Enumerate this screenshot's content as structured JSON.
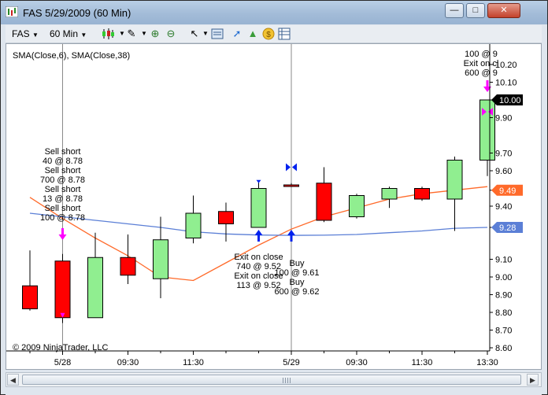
{
  "window": {
    "title": "FAS  5/29/2009 (60 Min)",
    "app_icon": "ninjatrader-chart-icon",
    "controls": {
      "minimize": "minimize-icon",
      "maximize": "maximize-icon",
      "close": "close-icon"
    }
  },
  "toolbar": {
    "instrument": "FAS",
    "interval": "60 Min",
    "icons": [
      "chart-style-candlestick-icon",
      "pencil-draw-icon",
      "zoom-in-icon",
      "zoom-out-icon",
      "pointer-cursor-icon",
      "data-box-icon",
      "indicators-icon",
      "strategies-icon",
      "money-management-icon",
      "properties-grid-icon"
    ]
  },
  "chart_data": {
    "type": "candlestick",
    "instrument": "FAS",
    "indicator_label": "SMA(Close,6), SMA(Close,38)",
    "copyright": "© 2009 NinjaTrader, LLC",
    "yaxis_ticks": [
      "10.20",
      "10.10",
      "10.00",
      "9.90",
      "9.70",
      "9.60",
      "9.49",
      "9.40",
      "9.28",
      "9.10",
      "9.00",
      "8.90",
      "8.80",
      "8.70",
      "8.60"
    ],
    "xaxis_ticks": [
      {
        "label": "5/28",
        "bar": 1
      },
      {
        "label": "09:30",
        "bar": 3
      },
      {
        "label": "11:30",
        "bar": 5
      },
      {
        "label": "5/29",
        "bar": 8
      },
      {
        "label": "09:30",
        "bar": 10
      },
      {
        "label": "11:30",
        "bar": 12
      },
      {
        "label": "13:30",
        "bar": 14
      }
    ],
    "ylim": [
      8.57,
      10.27
    ],
    "bars": [
      {
        "open": 8.95,
        "high": 9.15,
        "low": 8.81,
        "close": 8.82
      },
      {
        "open": 9.09,
        "high": 9.13,
        "low": 8.74,
        "close": 8.77
      },
      {
        "open": 8.77,
        "high": 9.25,
        "low": 8.77,
        "close": 9.11
      },
      {
        "open": 9.11,
        "high": 9.24,
        "low": 8.96,
        "close": 9.01
      },
      {
        "open": 8.99,
        "high": 9.34,
        "low": 8.88,
        "close": 9.21
      },
      {
        "open": 9.22,
        "high": 9.46,
        "low": 9.19,
        "close": 9.36
      },
      {
        "open": 9.37,
        "high": 9.42,
        "low": 9.2,
        "close": 9.3
      },
      {
        "open": 9.28,
        "high": 9.54,
        "low": 9.28,
        "close": 9.5
      },
      {
        "open": 9.52,
        "high": 9.53,
        "low": 9.52,
        "close": 9.52
      },
      {
        "open": 9.53,
        "high": 9.62,
        "low": 9.31,
        "close": 9.32
      },
      {
        "open": 9.34,
        "high": 9.47,
        "low": 9.33,
        "close": 9.46
      },
      {
        "open": 9.44,
        "high": 9.51,
        "low": 9.39,
        "close": 9.5
      },
      {
        "open": 9.5,
        "high": 9.51,
        "low": 9.43,
        "close": 9.44
      },
      {
        "open": 9.44,
        "high": 9.68,
        "low": 9.26,
        "close": 9.66
      },
      {
        "open": 9.66,
        "high": 10.0,
        "low": 9.57,
        "close": 10.0
      }
    ],
    "series": [
      {
        "name": "SMA(Close,6)",
        "color": "#ff6a2a",
        "values": [
          9.45,
          9.33,
          9.22,
          9.12,
          9.0,
          8.98,
          9.08,
          9.18,
          9.27,
          9.34,
          9.39,
          9.44,
          9.47,
          9.49,
          9.51
        ]
      },
      {
        "name": "SMA(Close,38)",
        "color": "#5b7fd6",
        "values": [
          9.36,
          9.34,
          9.32,
          9.3,
          9.28,
          9.255,
          9.243,
          9.237,
          9.235,
          9.236,
          9.24,
          9.25,
          9.26,
          9.275,
          9.28
        ]
      }
    ],
    "price_markers": [
      {
        "value": "10.00",
        "price": 10.0,
        "bg": "#000000",
        "fg": "#ffffff"
      },
      {
        "value": "9.49",
        "price": 9.49,
        "bg": "#ff6a2a",
        "fg": "#ffffff"
      },
      {
        "value": "9.28",
        "price": 9.28,
        "bg": "#5b7fd6",
        "fg": "#ffffff"
      }
    ],
    "vertical_lines": [
      1,
      8
    ],
    "annotations": [
      {
        "bar": 1,
        "text": [
          "Sell short",
          "40 @ 8.78",
          "Sell short",
          "700 @ 8.78",
          "Sell short",
          "13 @ 8.78",
          "Sell short",
          "100 @ 8.78"
        ],
        "marker": "magenta-down-arrow"
      },
      {
        "bar": 7,
        "text": [
          "Exit on close",
          "740 @ 9.52",
          "Exit on close",
          "113 @ 9.52"
        ],
        "marker": "blue-up-arrow"
      },
      {
        "bar": 8,
        "text": [
          "Buy",
          "100 @ 9.61",
          "Buy",
          "600 @ 9.62"
        ],
        "marker": "blue-up-arrow"
      },
      {
        "bar": 14,
        "text": [
          "100 @ 9",
          "Exit on cl",
          "600 @ 9"
        ],
        "marker": "magenta-down-arrow"
      }
    ],
    "colors": {
      "up": "#90ee90",
      "down": "#ff0000",
      "grid": "#e6e6e6",
      "background": "#ffffff"
    }
  },
  "scrollbar": {
    "left_icon": "scroll-left-icon",
    "right_icon": "scroll-right-icon"
  }
}
